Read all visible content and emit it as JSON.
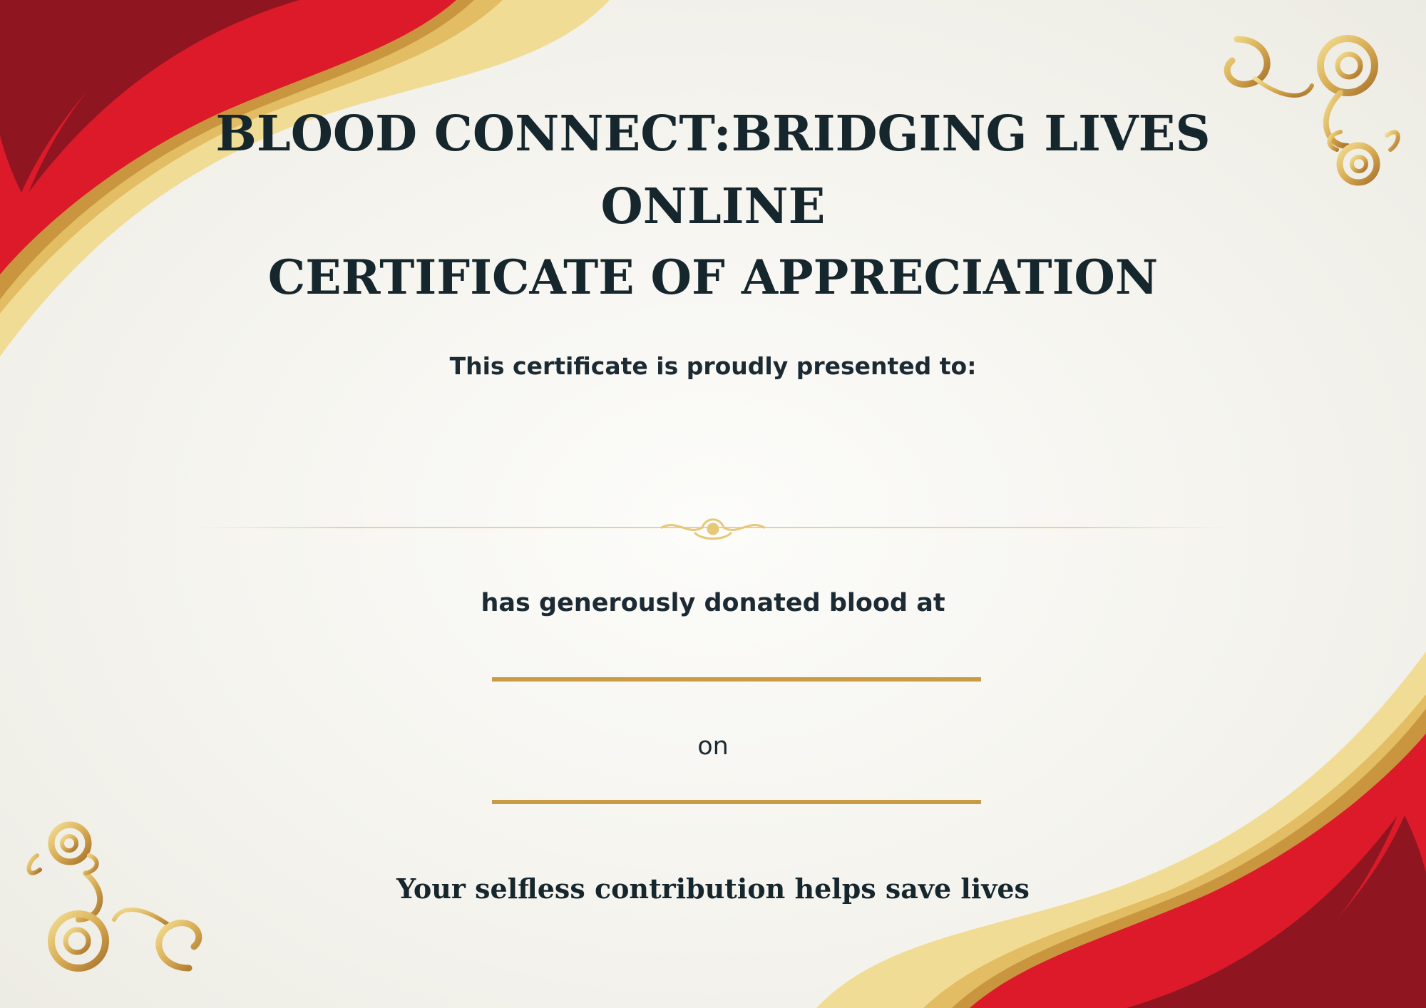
{
  "certificate": {
    "title_line1": "BLOOD CONNECT:BRIDGING LIVES",
    "title_line2": "ONLINE",
    "title_line3": "CERTIFICATE OF APPRECIATION",
    "presented_text": "This certificate is proudly presented to:",
    "recipient_name": "",
    "donated_text": "has generously donated blood at",
    "venue_value": "",
    "on_text": "on",
    "date_value": "",
    "closing_text": "Your selfless contribution helps save lives"
  },
  "colors": {
    "dark_red": "#8f1620",
    "red": "#dc1a2a",
    "gold": "#c99b45",
    "light_gold": "#f1dc95",
    "text_dark": "#15262d"
  },
  "icons": {
    "top_right_ornament": "ornate-scroll-corner",
    "bottom_left_ornament": "ornate-scroll-corner",
    "center_divider": "flourish-divider"
  }
}
